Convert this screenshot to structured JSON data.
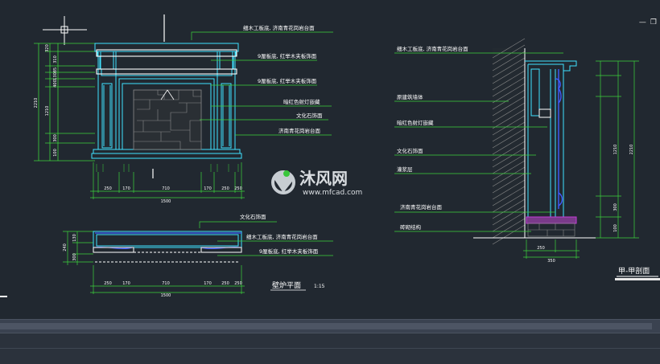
{
  "front_labels": [
    "细木工板底, 济南青花岗岩台面",
    "9厘板底, 红举木夹板饰面",
    "9厘板底, 红举木夹板饰面",
    "暗红色射灯嵌藏",
    "文化石饰面",
    "济南青花岗岩台面"
  ],
  "front_dims": [
    "1500",
    "250",
    "710",
    "170",
    "250",
    "170",
    "250"
  ],
  "front_left_dims": [
    "2210",
    "320",
    "310",
    "85",
    "130",
    "400",
    "1210",
    "300",
    "100"
  ],
  "plan_labels": [
    "文化石饰面",
    "细木工板底, 济南青花岗岩台面",
    "9厘板底, 红举木夹板饰面"
  ],
  "plan_dims": [
    "1500",
    "250",
    "710",
    "170",
    "250",
    "170",
    "250"
  ],
  "plan_left_dims": [
    "240",
    "130",
    "300"
  ],
  "plan_title": "壁炉平面",
  "plan_scale": "1:15",
  "section_labels": [
    "细木工板底, 济南青花岗岩台面",
    "原建筑墙体",
    "暗红色射灯嵌藏",
    "文化石饰面",
    "灌浆层",
    "济南青花岗岩台面",
    "砖砌结构"
  ],
  "section_dims": [
    "250",
    "350"
  ],
  "section_right_dims": [
    "2210",
    "1210",
    "300",
    "100"
  ],
  "section_title": "甲-甲剖面",
  "watermark_name": "沐风网",
  "watermark_url": "www.mfcad.com",
  "colors": {
    "bg": "#212830",
    "cyan": "#3fe2ff",
    "white": "#ffffff",
    "green": "#3cd43c",
    "gray": "#8a8a8a",
    "blue": "#3f5cff",
    "magenta": "#c33cd6"
  }
}
